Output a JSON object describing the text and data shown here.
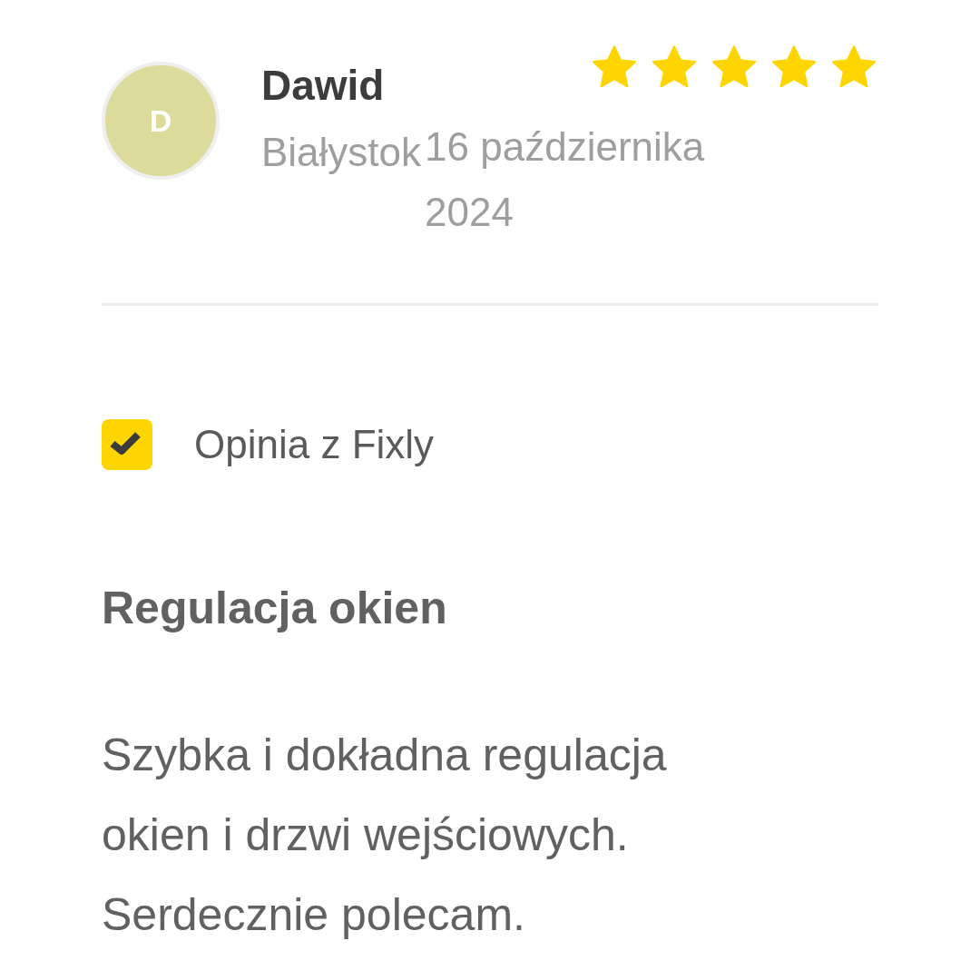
{
  "reviewer": {
    "initial": "D",
    "name": "Dawid",
    "location": "Białystok",
    "date": "16 października 2024",
    "stars": 5
  },
  "source": {
    "label": "Opinia z Fixly",
    "verified": true
  },
  "review": {
    "title": "Regulacja okien",
    "text": "Szybka i dokładna regulacja okien i drzwi wejściowych. Serdecznie polecam."
  }
}
